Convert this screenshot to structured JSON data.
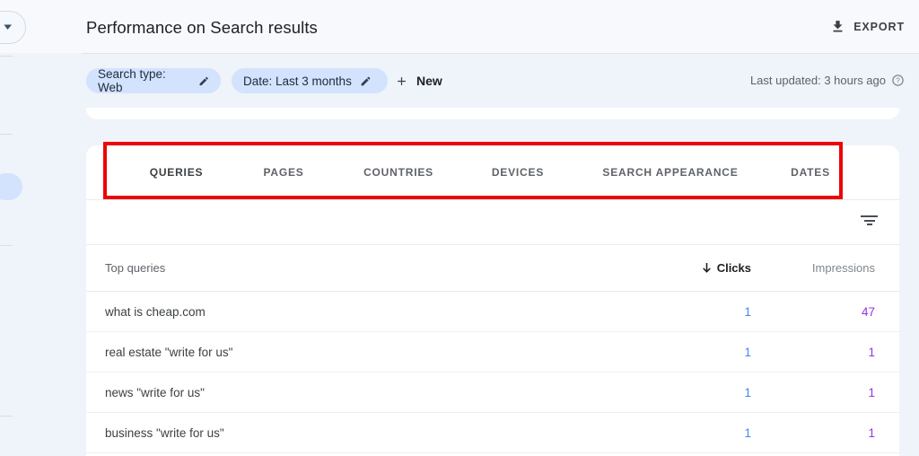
{
  "header": {
    "title": "Performance on Search results",
    "export_label": "EXPORT"
  },
  "filters": {
    "chips": [
      {
        "label": "Search type: Web"
      },
      {
        "label": "Date: Last 3 months"
      }
    ],
    "new_label": "New",
    "last_updated": "Last updated: 3 hours ago"
  },
  "tabs": {
    "items": [
      {
        "label": "QUERIES",
        "active": true
      },
      {
        "label": "PAGES",
        "active": false
      },
      {
        "label": "COUNTRIES",
        "active": false
      },
      {
        "label": "DEVICES",
        "active": false
      },
      {
        "label": "SEARCH APPEARANCE",
        "active": false
      },
      {
        "label": "DATES",
        "active": false
      }
    ]
  },
  "table": {
    "header": {
      "queries": "Top queries",
      "clicks": "Clicks",
      "impressions": "Impressions"
    },
    "rows": [
      {
        "query": "what is cheap.com",
        "clicks": "1",
        "impressions": "47"
      },
      {
        "query": "real estate \"write for us\"",
        "clicks": "1",
        "impressions": "1"
      },
      {
        "query": "news \"write for us\"",
        "clicks": "1",
        "impressions": "1"
      },
      {
        "query": "business \"write for us\"",
        "clicks": "1",
        "impressions": "1"
      }
    ]
  },
  "colors": {
    "chip_background": "#d3e3fd",
    "clicks_value": "#4285f4",
    "impressions_value": "#9334e6",
    "annotation_red": "#ec0606",
    "active_tab_underline": "#3c4043",
    "page_background": "#eff3fa"
  }
}
